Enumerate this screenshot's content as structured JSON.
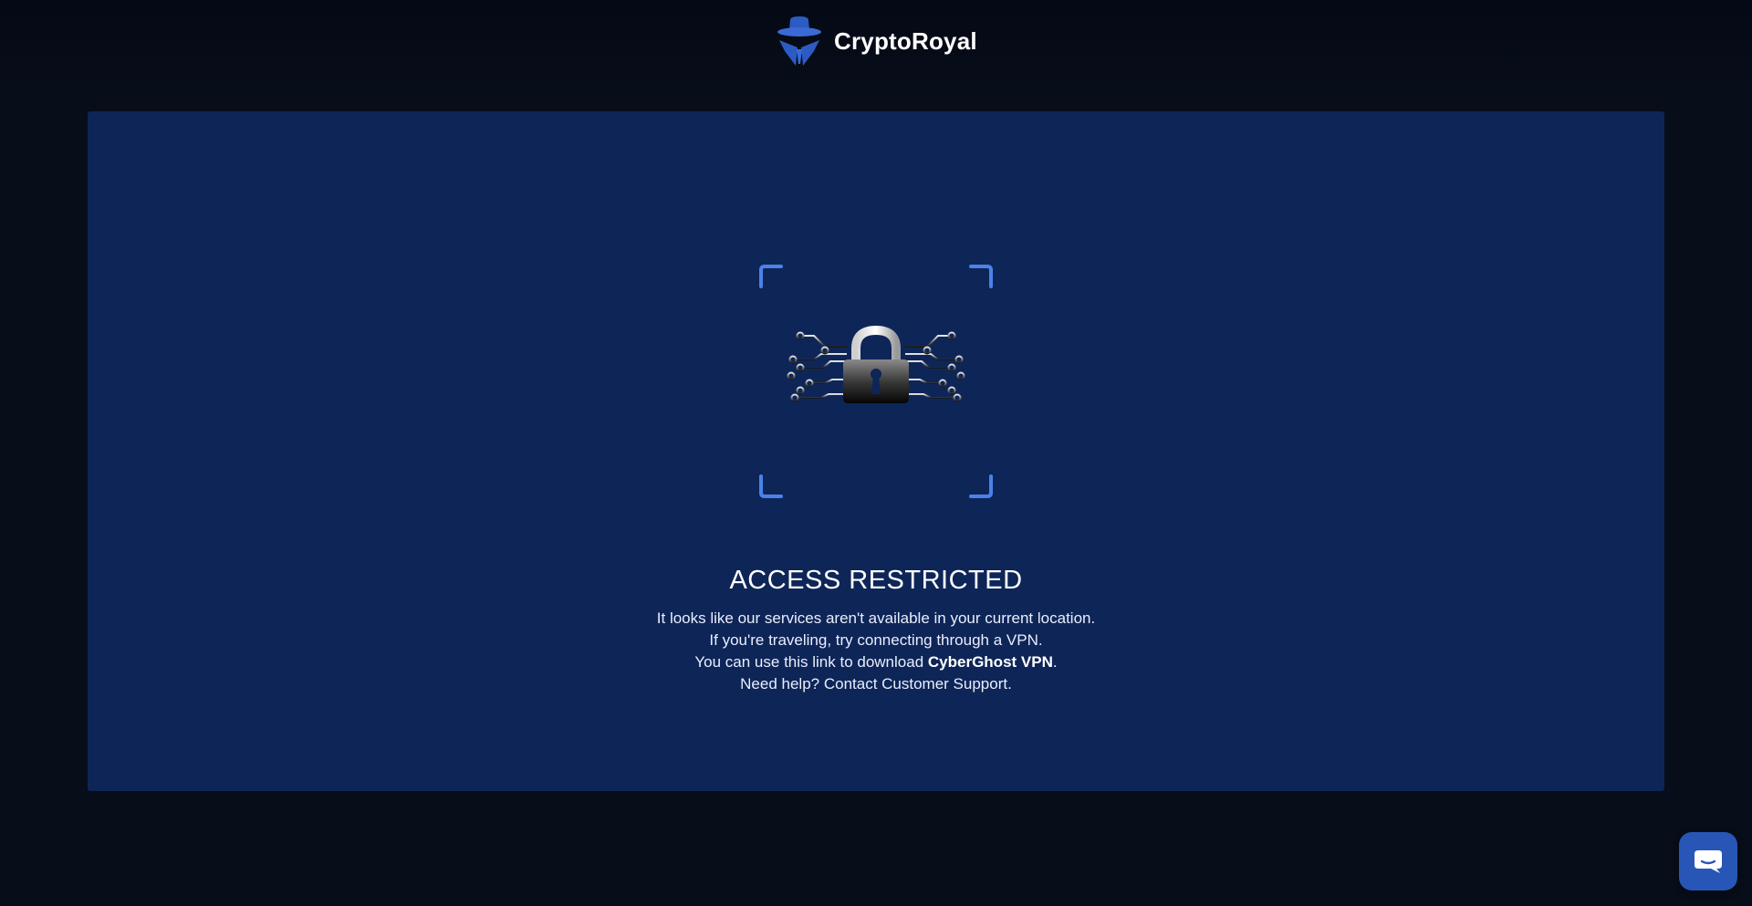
{
  "header": {
    "brand_name": "CryptoRoyal",
    "logo_icon": "spy-hat-logo-icon"
  },
  "main": {
    "illustration_icon": "padlock-circuit-icon",
    "title": "ACCESS RESTRICTED",
    "line1": "It looks like our services aren't available in your current location.",
    "line2": "If you're traveling, try connecting through a VPN.",
    "line3_prefix": "You can use this link to download ",
    "line3_link": "CyberGhost VPN",
    "line3_suffix": ".",
    "line4": "Need help? Contact Customer Support."
  },
  "chat": {
    "icon": "chat-bubble-icon"
  },
  "colors": {
    "background": "#070d19",
    "panel": "#0e2558",
    "accent": "#2856b6",
    "corner_brackets": "#4a82e8"
  }
}
